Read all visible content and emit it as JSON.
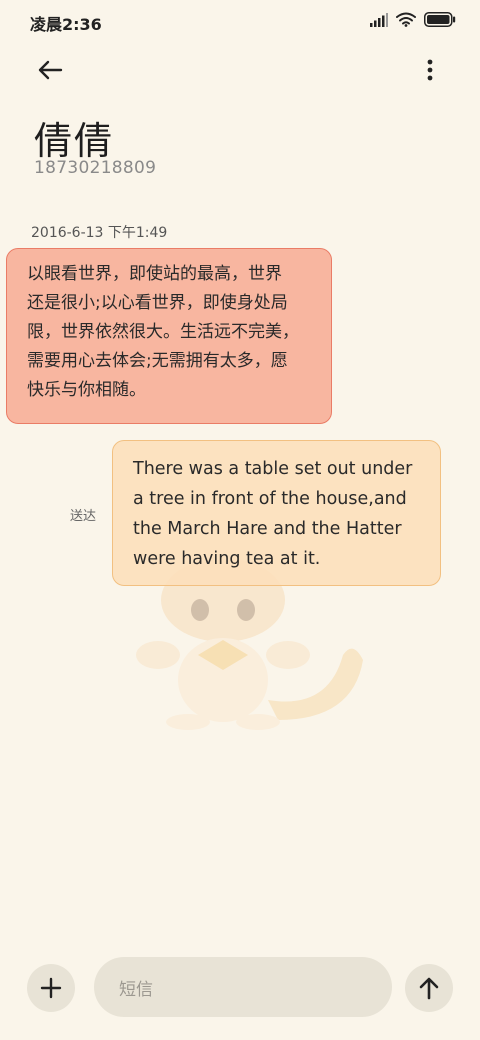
{
  "status_bar": {
    "time": "凌晨2:36",
    "icons": [
      "signal-icon",
      "wifi-icon",
      "battery-icon"
    ]
  },
  "header": {
    "back_icon": "arrow-left-icon",
    "more_icon": "more-vertical-icon"
  },
  "contact": {
    "name": "倩倩",
    "number": "18730218809"
  },
  "conversation": {
    "timestamp": "2016-6-13 下午1:49",
    "messages": [
      {
        "direction": "incoming",
        "lines": [
          "以眼看世界，即使站的最高，世界",
          "还是很小;以心看世界，即使身处局",
          "限，世界依然很大。生活远不完美，",
          "需要用心去体会;无需拥有太多，愿",
          "快乐与你相随。"
        ]
      },
      {
        "direction": "outgoing",
        "status": "送达",
        "lines": [
          "There was a table set out under",
          "a tree in front of the house,and",
          "the March Hare and the Hatter",
          "were having tea at it."
        ]
      }
    ]
  },
  "composer": {
    "add_icon": "plus-icon",
    "placeholder": "短信",
    "send_icon": "arrow-up-icon"
  },
  "colors": {
    "background": "#faf5ea",
    "incoming_bubble": "#f8b6a0",
    "incoming_border": "#ea7c66",
    "outgoing_bubble": "#fce0bc",
    "outgoing_border": "#f2c081",
    "control_bg": "#e8e3d6"
  }
}
